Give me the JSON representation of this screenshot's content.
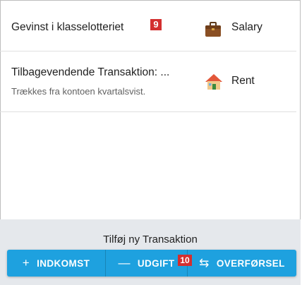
{
  "transactions": [
    {
      "title": "Gevinst i klasselotteriet",
      "badge": "9",
      "category": "Salary",
      "category_icon": "briefcase-icon"
    },
    {
      "title": "Tilbagevendende Transaktion: ...",
      "subtitle": "Trækkes fra kontoen kvartalsvist.",
      "category": "Rent",
      "category_icon": "house-icon"
    }
  ],
  "footer": {
    "title": "Tilføj ny Transaktion",
    "buttons": [
      {
        "label": "INDKOMST",
        "symbol": "+"
      },
      {
        "label": "UDGIFT",
        "symbol": "—",
        "badge": "10"
      },
      {
        "label": "OVERFØRSEL",
        "symbol": "⇆"
      }
    ]
  },
  "colors": {
    "accent": "#1ea1df",
    "footer_bg": "#e5e8ec",
    "badge": "#d32f2f"
  }
}
